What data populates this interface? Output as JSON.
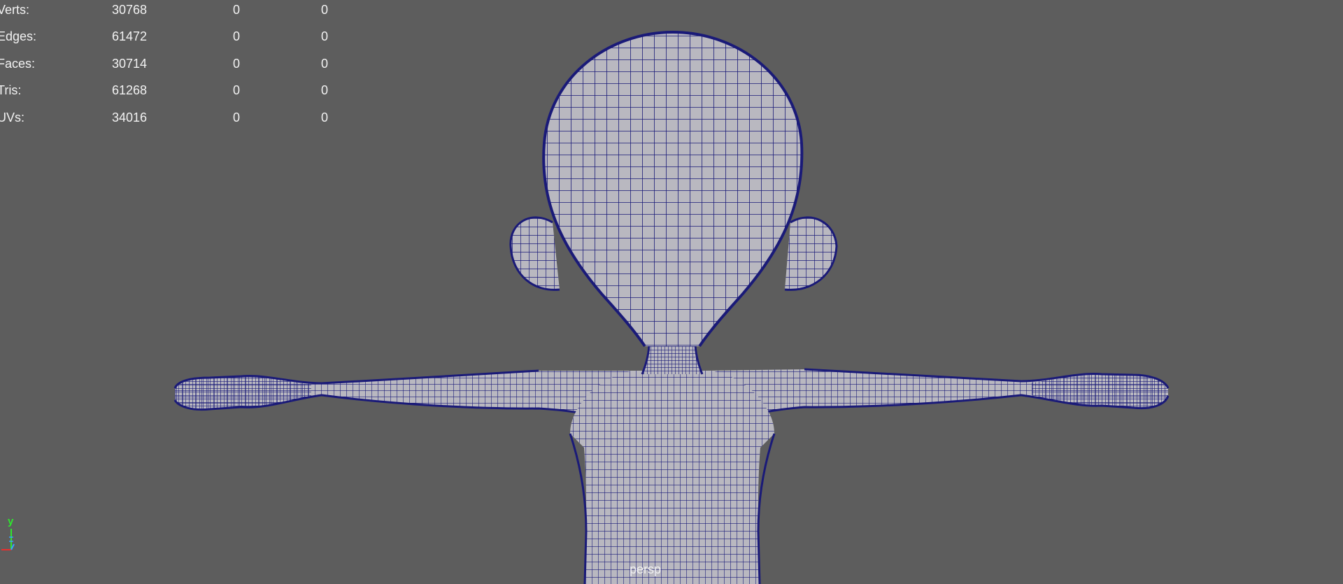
{
  "heads_up_display": {
    "rows": [
      {
        "label": "Verts:",
        "total": "30768",
        "selected": "0",
        "selected_component": "0"
      },
      {
        "label": "Edges:",
        "total": "61472",
        "selected": "0",
        "selected_component": "0"
      },
      {
        "label": "Faces:",
        "total": "30714",
        "selected": "0",
        "selected_component": "0"
      },
      {
        "label": "Tris:",
        "total": "61268",
        "selected": "0",
        "selected_component": "0"
      },
      {
        "label": "UVs:",
        "total": "34016",
        "selected": "0",
        "selected_component": "0"
      }
    ]
  },
  "viewport": {
    "camera_name": "persp",
    "background_color": "#5d5d5d",
    "wireframe_color": "#1a1a78",
    "shaded_color": "#b9b8c0"
  },
  "axis_indicator": {
    "y_label": "y",
    "icon": "xyz-axis-gizmo-icon",
    "y_color": "#2ee82e",
    "x_color": "#e82e2e",
    "z_color": "#3aa0ff"
  },
  "model": {
    "icon": "character-mesh-wireframe"
  }
}
